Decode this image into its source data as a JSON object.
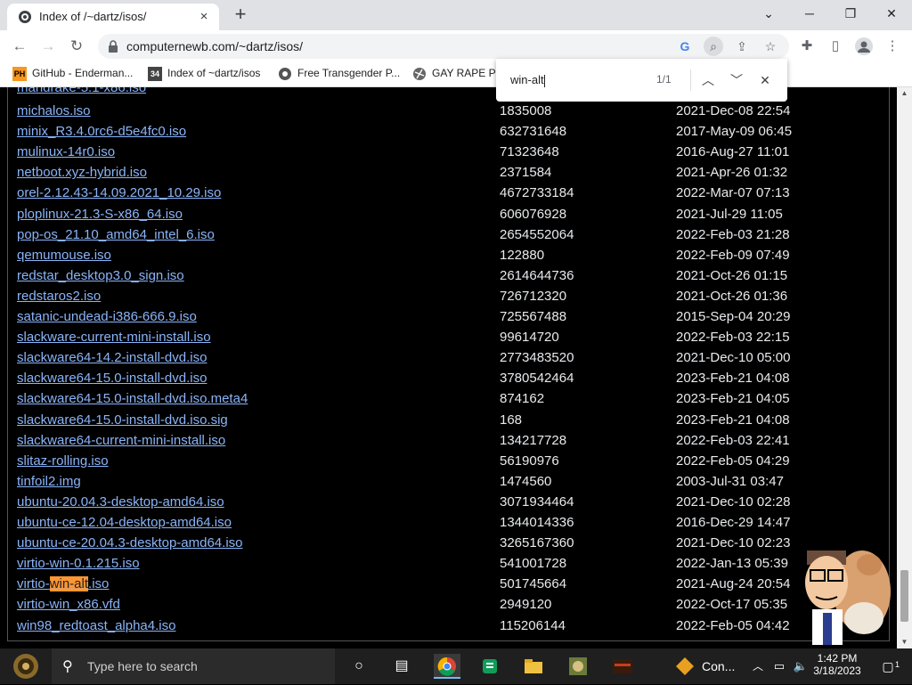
{
  "browser": {
    "tab_title": "Index of /~dartz/isos/",
    "url": "computernewb.com/~dartz/isos/",
    "new_tab_symbol": "+",
    "close_tab_symbol": "×"
  },
  "window_controls": {
    "tab_search": "⌄",
    "minimize": "─",
    "restore": "❐",
    "close": "✕"
  },
  "bookmarks": [
    {
      "label": "GitHub - Enderman...",
      "badge": "PH",
      "color": "#f7971d"
    },
    {
      "label": "Index of ~dartz/isos",
      "badge": "34",
      "color": "#444444"
    },
    {
      "label": "Free Transgender P...",
      "badge": "",
      "color": "#555555"
    },
    {
      "label": "GAY RAPE PO",
      "badge": "",
      "color": "#555555"
    }
  ],
  "find_bar": {
    "query": "win-alt",
    "count": "1/1"
  },
  "partial_top_file": "mandrake-5.1-x86.iso",
  "files": [
    {
      "name": "michalos.iso",
      "size": "1835008",
      "date": "2021-Dec-08 22:54"
    },
    {
      "name": "minix_R3.4.0rc6-d5e4fc0.iso",
      "size": "632731648",
      "date": "2017-May-09 06:45"
    },
    {
      "name": "mulinux-14r0.iso",
      "size": "71323648",
      "date": "2016-Aug-27 11:01"
    },
    {
      "name": "netboot.xyz-hybrid.iso",
      "size": "2371584",
      "date": "2021-Apr-26 01:32"
    },
    {
      "name": "orel-2.12.43-14.09.2021_10.29.iso",
      "size": "4672733184",
      "date": "2022-Mar-07 07:13"
    },
    {
      "name": "ploplinux-21.3-S-x86_64.iso",
      "size": "606076928",
      "date": "2021-Jul-29 11:05"
    },
    {
      "name": "pop-os_21.10_amd64_intel_6.iso",
      "size": "2654552064",
      "date": "2022-Feb-03 21:28"
    },
    {
      "name": "qemumouse.iso",
      "size": "122880",
      "date": "2022-Feb-09 07:49"
    },
    {
      "name": "redstar_desktop3.0_sign.iso",
      "size": "2614644736",
      "date": "2021-Oct-26 01:15"
    },
    {
      "name": "redstaros2.iso",
      "size": "726712320",
      "date": "2021-Oct-26 01:36"
    },
    {
      "name": "satanic-undead-i386-666.9.iso",
      "size": "725567488",
      "date": "2015-Sep-04 20:29"
    },
    {
      "name": "slackware-current-mini-install.iso",
      "size": "99614720",
      "date": "2022-Feb-03 22:15"
    },
    {
      "name": "slackware64-14.2-install-dvd.iso",
      "size": "2773483520",
      "date": "2021-Dec-10 05:00"
    },
    {
      "name": "slackware64-15.0-install-dvd.iso",
      "size": "3780542464",
      "date": "2023-Feb-21 04:08"
    },
    {
      "name": "slackware64-15.0-install-dvd.iso.meta4",
      "size": "874162",
      "date": "2023-Feb-21 04:05"
    },
    {
      "name": "slackware64-15.0-install-dvd.iso.sig",
      "size": "168",
      "date": "2023-Feb-21 04:08"
    },
    {
      "name": "slackware64-current-mini-install.iso",
      "size": "134217728",
      "date": "2022-Feb-03 22:41"
    },
    {
      "name": "slitaz-rolling.iso",
      "size": "56190976",
      "date": "2022-Feb-05 04:29"
    },
    {
      "name": "tinfoil2.img",
      "size": "1474560",
      "date": "2003-Jul-31 03:47"
    },
    {
      "name": "ubuntu-20.04.3-desktop-amd64.iso",
      "size": "3071934464",
      "date": "2021-Dec-10 02:28"
    },
    {
      "name": "ubuntu-ce-12.04-desktop-amd64.iso",
      "size": "1344014336",
      "date": "2016-Dec-29 14:47"
    },
    {
      "name": "ubuntu-ce-20.04.3-desktop-amd64.iso",
      "size": "3265167360",
      "date": "2021-Dec-10 02:23"
    },
    {
      "name": "virtio-win-0.1.215.iso",
      "size": "541001728",
      "date": "2022-Jan-13 05:39"
    },
    {
      "name": "virtio-win-alt.iso",
      "size": "501745664",
      "date": "2021-Aug-24 20:54",
      "match_prefix": "virtio-",
      "match": "win-alt",
      "match_suffix": ".iso"
    },
    {
      "name": "virtio-win_x86.vfd",
      "size": "2949120",
      "date": "2022-Oct-17 05:35"
    },
    {
      "name": "win98_redtoast_alpha4.iso",
      "size": "115206144",
      "date": "2022-Feb-05 04:42"
    }
  ],
  "taskbar": {
    "search_placeholder": "Type here to search",
    "app_label": "Con...",
    "time": "1:42 PM",
    "date": "3/18/2023",
    "notifications": "1"
  },
  "colors": {
    "link": "#8ab4f8",
    "highlight": "#ff9632"
  }
}
